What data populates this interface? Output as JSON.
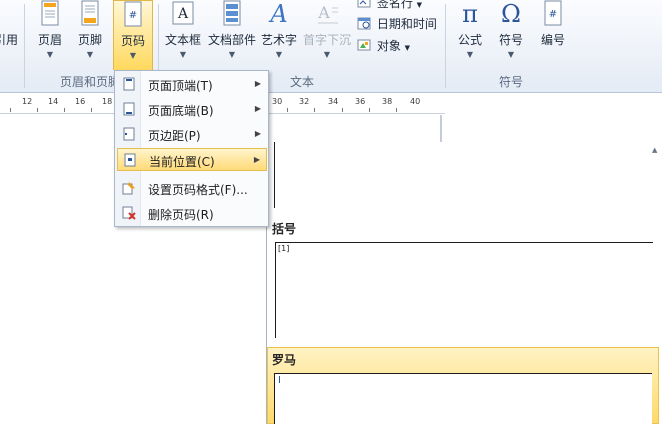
{
  "ribbon": {
    "buttons": {
      "cross_ref": "引用",
      "header": "页眉",
      "footer": "页脚",
      "page_number": "页码",
      "text_box": "文本框",
      "quick_parts": "文档部件",
      "word_art": "艺术字",
      "drop_cap": "首字下沉",
      "equation": "公式",
      "symbol": "符号",
      "number": "编号"
    },
    "small": {
      "signature_line": "签名行",
      "date_time": "日期和时间",
      "object": "对象"
    },
    "groups": {
      "header_footer": "页眉和页脚",
      "text": "文本",
      "symbols": "符号"
    }
  },
  "ruler": {
    "ticks": [
      "12",
      "14",
      "16",
      "18",
      "30",
      "32",
      "34",
      "36",
      "38",
      "40"
    ]
  },
  "menu": {
    "items": [
      {
        "label": "页面顶端(T)",
        "has_submenu": true
      },
      {
        "label": "页面底端(B)",
        "has_submenu": true
      },
      {
        "label": "页边距(P)",
        "has_submenu": true
      },
      {
        "label": "当前位置(C)",
        "has_submenu": true,
        "state": "hover"
      },
      {
        "label": "设置页码格式(F)...",
        "has_submenu": false
      },
      {
        "label": "删除页码(R)",
        "has_submenu": false
      }
    ]
  },
  "gallery": {
    "section1": "括号",
    "section1_sample": "[1]",
    "section2": "罗马",
    "section2_sample": "I"
  },
  "colors": {
    "ribbon_bg": "#e4ebf5",
    "highlight": "#ffd96a",
    "accent_blue": "#2b579a"
  }
}
